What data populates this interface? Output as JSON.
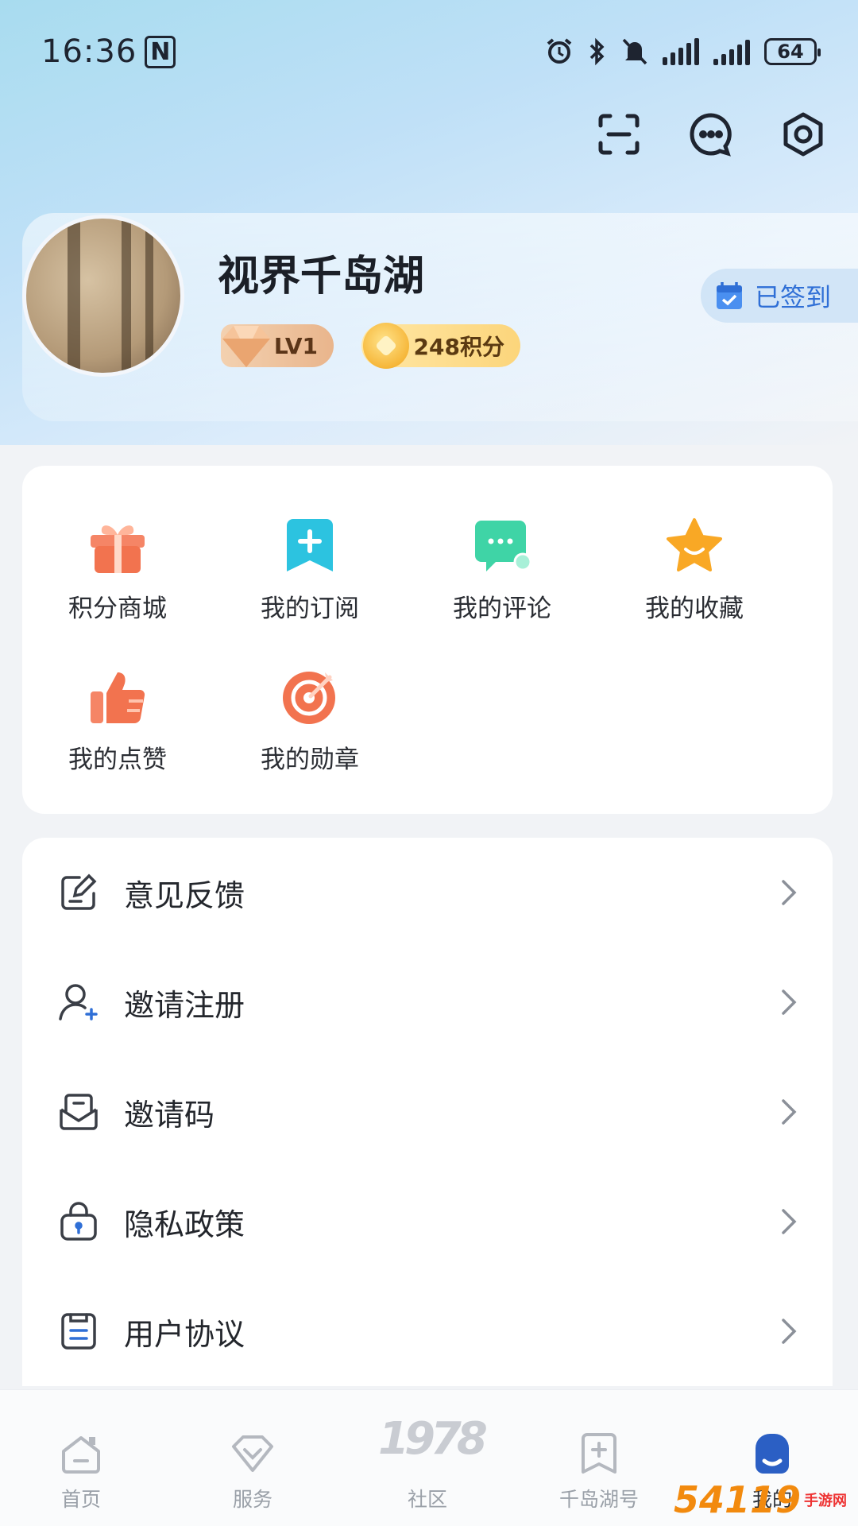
{
  "status_bar": {
    "time": "16:36",
    "nfc_icon": "N",
    "battery": "64",
    "icons": [
      "alarm-icon",
      "bluetooth-icon",
      "mute-icon",
      "signal-icon",
      "signal-icon"
    ]
  },
  "header": {
    "actions": [
      {
        "name": "scan-icon"
      },
      {
        "name": "message-icon"
      },
      {
        "name": "settings-icon"
      }
    ]
  },
  "profile": {
    "username": "视界千岛湖",
    "level": "LV1",
    "points": "248积分",
    "checkin_label": "已签到"
  },
  "quick_grid": [
    {
      "label": "积分商城",
      "icon": "gift-icon",
      "color": "#f2734f"
    },
    {
      "label": "我的订阅",
      "icon": "bookmark-plus-icon",
      "color": "#2cc3e0"
    },
    {
      "label": "我的评论",
      "icon": "comment-icon",
      "color": "#3fd4a6"
    },
    {
      "label": "我的收藏",
      "icon": "star-icon",
      "color": "#f9a825"
    },
    {
      "label": "我的点赞",
      "icon": "thumbs-up-icon",
      "color": "#f2734f"
    },
    {
      "label": "我的勋章",
      "icon": "medal-target-icon",
      "color": "#f2734f"
    }
  ],
  "menu": [
    {
      "label": "意见反馈",
      "icon": "feedback-edit-icon"
    },
    {
      "label": "邀请注册",
      "icon": "user-add-icon"
    },
    {
      "label": "邀请码",
      "icon": "mail-icon"
    },
    {
      "label": "隐私政策",
      "icon": "lock-icon"
    },
    {
      "label": "用户协议",
      "icon": "document-icon"
    }
  ],
  "bottom_nav": [
    {
      "label": "首页",
      "icon": "home-icon"
    },
    {
      "label": "服务",
      "icon": "diamond-icon"
    },
    {
      "label": "社区",
      "icon": "community-1978-icon"
    },
    {
      "label": "千岛湖号",
      "icon": "bookmark-plus-icon"
    },
    {
      "label": "我的",
      "icon": "profile-icon",
      "active": true
    }
  ],
  "center_art_text": "1978",
  "watermark": {
    "main": "54119",
    "sub": "手游网"
  }
}
